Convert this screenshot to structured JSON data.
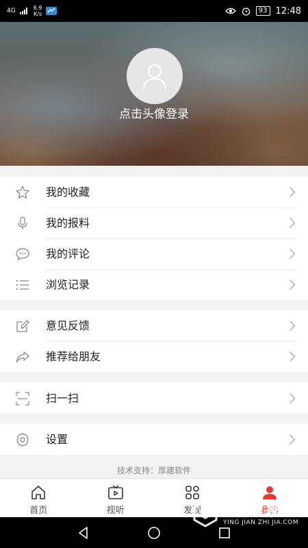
{
  "status_bar": {
    "network_type": "4G",
    "net_speed": "6.9",
    "net_speed_unit": "K/s",
    "battery": "93",
    "time": "12:48"
  },
  "profile": {
    "login_prompt": "点击头像登录"
  },
  "menu_groups": [
    [
      {
        "label": "我的收藏",
        "icon": "star-icon"
      },
      {
        "label": "我的报料",
        "icon": "microphone-icon"
      },
      {
        "label": "我的评论",
        "icon": "comment-icon"
      },
      {
        "label": "浏览记录",
        "icon": "list-icon"
      }
    ],
    [
      {
        "label": "意见反馈",
        "icon": "edit-icon"
      },
      {
        "label": "推荐给朋友",
        "icon": "share-icon"
      }
    ],
    [
      {
        "label": "扫一扫",
        "icon": "scan-icon"
      }
    ],
    [
      {
        "label": "设置",
        "icon": "gear-icon"
      }
    ]
  ],
  "footer": {
    "support_text": "技术支持：厚建软件"
  },
  "tabbar": {
    "tabs": [
      {
        "label": "首页",
        "icon": "home-icon"
      },
      {
        "label": "视听",
        "icon": "video-icon"
      },
      {
        "label": "发现",
        "icon": "discover-icon"
      },
      {
        "label": "我的",
        "icon": "profile-icon"
      }
    ],
    "active_index": 3,
    "active_color": "#e8382f"
  },
  "watermark": {
    "title": "硬件之家",
    "subtitle": "YING JIAN ZHI JIA.COM"
  }
}
